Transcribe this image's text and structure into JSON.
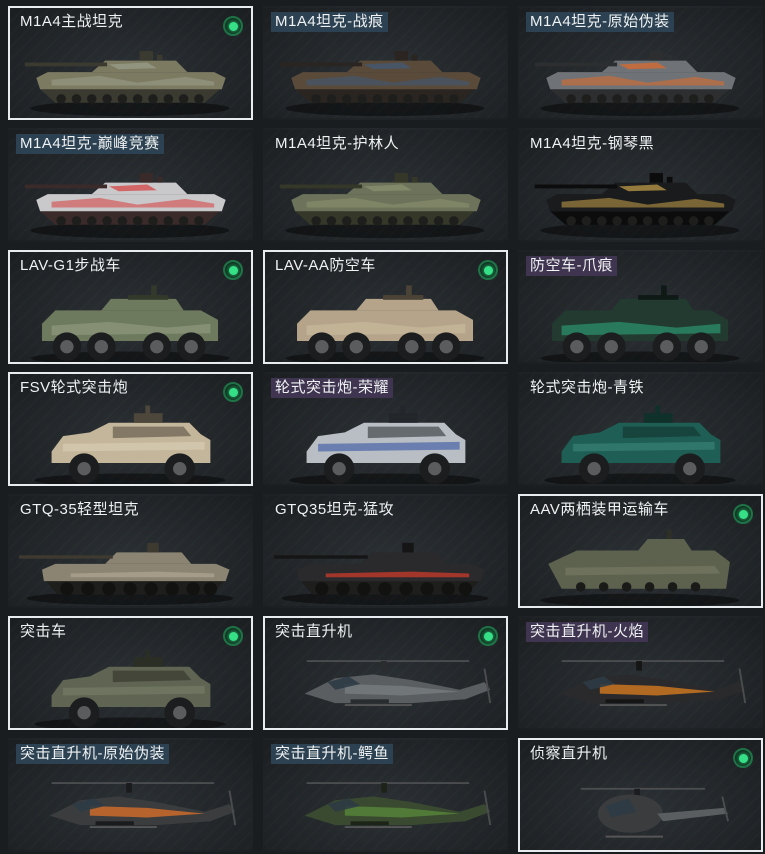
{
  "vehicles": [
    {
      "name": "M1A4主战坦克",
      "owned": true,
      "tier": "normal",
      "type": "tank",
      "colors": {
        "body": "#7d7a62",
        "accent": "#9aa08a",
        "dark": "#3a3a30"
      }
    },
    {
      "name": "M1A4坦克-战痕",
      "owned": false,
      "tier": "blue",
      "type": "tank",
      "colors": {
        "body": "#5a4a3a",
        "accent": "#3e5a7a",
        "dark": "#2a2520"
      }
    },
    {
      "name": "M1A4坦克-原始伪装",
      "owned": false,
      "tier": "blue",
      "type": "tank",
      "colors": {
        "body": "#6f7377",
        "accent": "#e06a2a",
        "dark": "#2c2e30"
      }
    },
    {
      "name": "M1A4坦克-巅峰竞赛",
      "owned": false,
      "tier": "blue",
      "type": "tank",
      "colors": {
        "body": "#c9c9cc",
        "accent": "#d63a3a",
        "dark": "#3a2a2a"
      }
    },
    {
      "name": "M1A4坦克-护林人",
      "owned": false,
      "tier": "normal",
      "type": "tank",
      "colors": {
        "body": "#6d735a",
        "accent": "#8c9270",
        "dark": "#353828"
      }
    },
    {
      "name": "M1A4坦克-钢琴黑",
      "owned": false,
      "tier": "normal",
      "type": "tank",
      "colors": {
        "body": "#1a1b1c",
        "accent": "#c9a24a",
        "dark": "#0c0c0d"
      }
    },
    {
      "name": "LAV-G1步战车",
      "owned": true,
      "tier": "normal",
      "type": "apc",
      "colors": {
        "body": "#6e7a5e",
        "accent": "#9aa48a",
        "dark": "#333a2c"
      }
    },
    {
      "name": "LAV-AA防空车",
      "owned": true,
      "tier": "normal",
      "type": "apc",
      "colors": {
        "body": "#b5a48a",
        "accent": "#d0c2a4",
        "dark": "#4a4336"
      }
    },
    {
      "name": "防空车-爪痕",
      "owned": false,
      "tier": "purple",
      "type": "apc",
      "colors": {
        "body": "#223a30",
        "accent": "#2fb98a",
        "dark": "#0f1a16"
      }
    },
    {
      "name": "FSV轮式突击炮",
      "owned": true,
      "tier": "normal",
      "type": "armored-car",
      "colors": {
        "body": "#c4b69a",
        "accent": "#ddd2ba",
        "dark": "#4d463a"
      }
    },
    {
      "name": "轮式突击炮-荣耀",
      "owned": false,
      "tier": "purple",
      "type": "armored-car",
      "colors": {
        "body": "#b9bec4",
        "accent": "#2a4aa0",
        "dark": "#23262b"
      }
    },
    {
      "name": "轮式突击炮-青铁",
      "owned": false,
      "tier": "normal",
      "type": "armored-car",
      "colors": {
        "body": "#1f5e54",
        "accent": "#3e8a7c",
        "dark": "#10302a"
      }
    },
    {
      "name": "GTQ-35轻型坦克",
      "owned": false,
      "tier": "normal",
      "type": "light-tank",
      "colors": {
        "body": "#8c8472",
        "accent": "#aaa28e",
        "dark": "#3e3a30"
      }
    },
    {
      "name": "GTQ35坦克-猛攻",
      "owned": false,
      "tier": "normal",
      "type": "light-tank",
      "colors": {
        "body": "#2a2a2c",
        "accent": "#c0392b",
        "dark": "#151516"
      }
    },
    {
      "name": "AAV两栖装甲运输车",
      "owned": true,
      "tier": "normal",
      "type": "amphibious",
      "colors": {
        "body": "#5d624e",
        "accent": "#7b806a",
        "dark": "#2e3026"
      }
    },
    {
      "name": "突击车",
      "owned": true,
      "tier": "normal",
      "type": "armored-car",
      "colors": {
        "body": "#5f6552",
        "accent": "#7c826c",
        "dark": "#2b2e25"
      }
    },
    {
      "name": "突击直升机",
      "owned": true,
      "tier": "normal",
      "type": "helicopter",
      "colors": {
        "body": "#5a5e60",
        "accent": "#7a7f82",
        "dark": "#2a2c2e"
      }
    },
    {
      "name": "突击直升机-火焰",
      "owned": false,
      "tier": "purple",
      "type": "helicopter",
      "colors": {
        "body": "#2a2a2c",
        "accent": "#e0801f",
        "dark": "#151516"
      }
    },
    {
      "name": "突击直升机-原始伪装",
      "owned": false,
      "tier": "blue",
      "type": "helicopter",
      "colors": {
        "body": "#3a3c3e",
        "accent": "#e0702a",
        "dark": "#1a1b1c"
      }
    },
    {
      "name": "突击直升机-鳄鱼",
      "owned": false,
      "tier": "blue",
      "type": "helicopter",
      "colors": {
        "body": "#3a4a30",
        "accent": "#5a8a3a",
        "dark": "#1c2418"
      }
    },
    {
      "name": "侦察直升机",
      "owned": true,
      "tier": "normal",
      "type": "scout-heli",
      "colors": {
        "body": "#3a3c3e",
        "accent": "#5a5e60",
        "dark": "#1b1c1d"
      }
    }
  ]
}
